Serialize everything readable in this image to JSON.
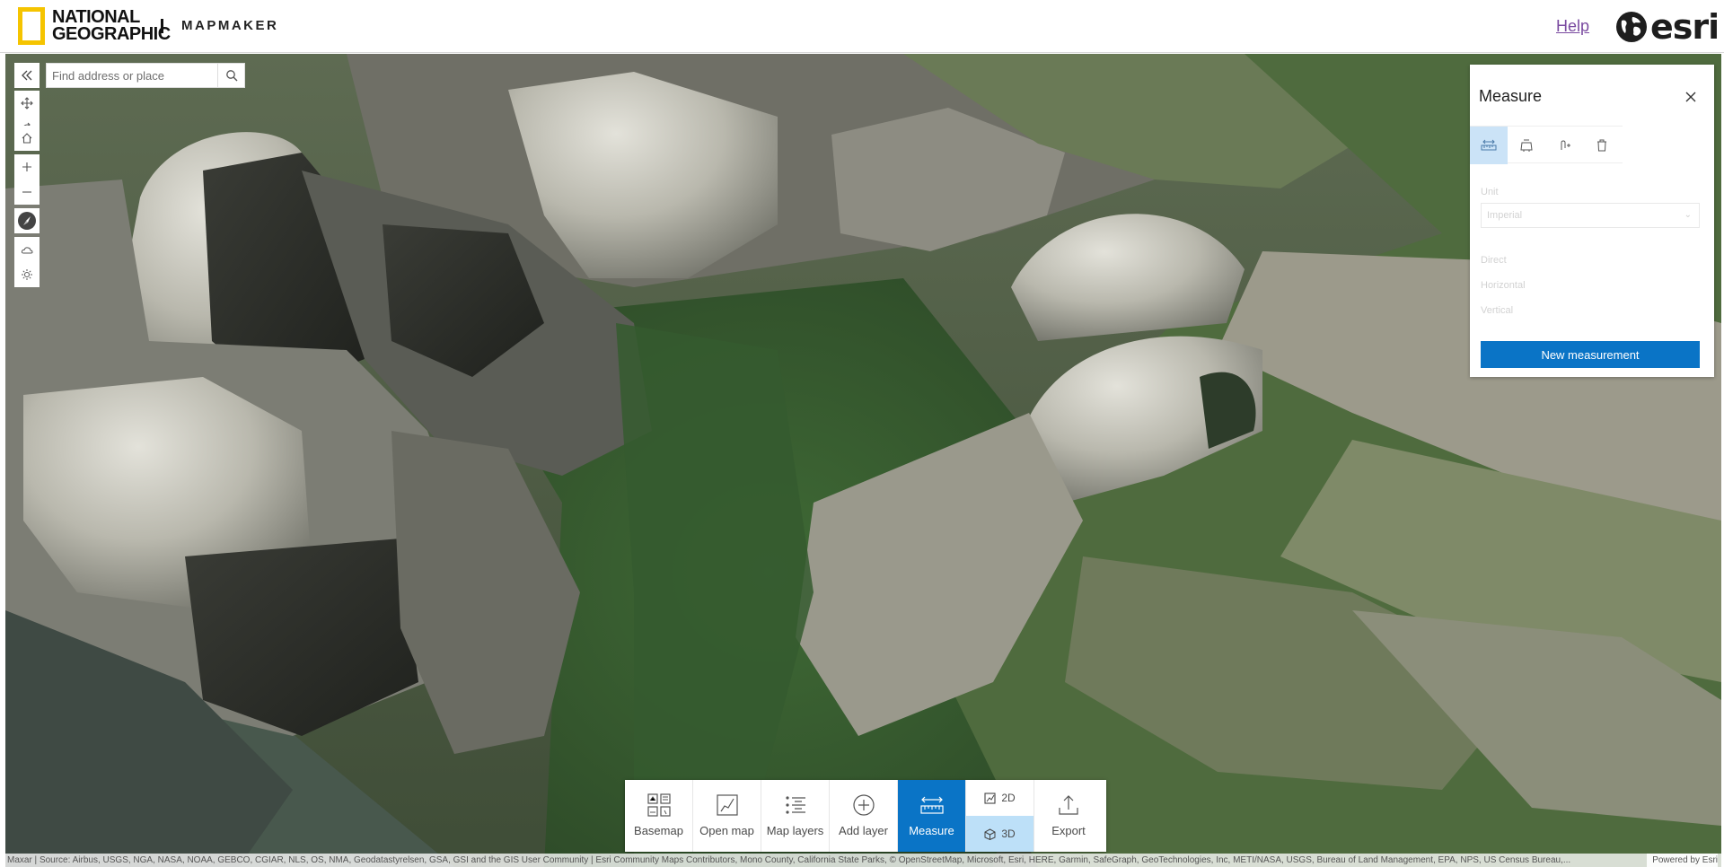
{
  "header": {
    "brand_line1": "NATIONAL",
    "brand_line2": "GEOGRAPHIC",
    "product": "MAPMAKER",
    "help_label": "Help",
    "partner_logo_text": "esri"
  },
  "search": {
    "placeholder": "Find address or place"
  },
  "left_tools": [
    {
      "icon": "pan-icon"
    },
    {
      "icon": "rotate-icon"
    },
    {
      "icon": "home-icon"
    },
    {
      "icon": "zoom-in-icon"
    },
    {
      "icon": "zoom-out-icon"
    },
    {
      "icon": "compass-icon"
    },
    {
      "icon": "daylight-icon"
    },
    {
      "icon": "weather-icon"
    }
  ],
  "measure_panel": {
    "title": "Measure",
    "tools": [
      {
        "icon": "distance-measure-icon",
        "active": true
      },
      {
        "icon": "area-measure-icon",
        "active": false
      },
      {
        "icon": "add-point-icon",
        "active": false
      },
      {
        "icon": "trash-icon",
        "active": false
      }
    ],
    "unit_label": "Unit",
    "unit_value": "Imperial",
    "fields": [
      "Direct",
      "Horizontal",
      "Vertical"
    ],
    "new_measurement_label": "New measurement"
  },
  "toolbar": {
    "items": [
      {
        "label": "Basemap",
        "icon": "basemap-icon"
      },
      {
        "label": "Open map",
        "icon": "open-map-icon"
      },
      {
        "label": "Map layers",
        "icon": "map-layers-icon"
      },
      {
        "label": "Add layer",
        "icon": "add-layer-icon"
      },
      {
        "label": "Measure",
        "icon": "measure-icon",
        "active": true
      }
    ],
    "view_2d_label": "2D",
    "view_3d_label": "3D",
    "view_active": "3D",
    "export_label": "Export"
  },
  "attribution": {
    "text": "Maxar | Source: Airbus, USGS, NGA, NASA, NOAA, GEBCO, CGIAR, NLS, OS, NMA, Geodatastyrelsen, GSA, GSI and the GIS User Community | Esri Community Maps Contributors, Mono County, California State Parks, © OpenStreetMap, Microsoft, Esri, HERE, Garmin, SafeGraph, GeoTechnologies, Inc, METI/NASA, USGS, Bureau of Land Management, EPA, NPS, US Census Bureau,...",
    "powered_by": "Powered by Esri"
  },
  "colors": {
    "accent": "#0a74c6",
    "active_tool_bg": "#cbe3f7",
    "ng_yellow": "#f5c400"
  }
}
